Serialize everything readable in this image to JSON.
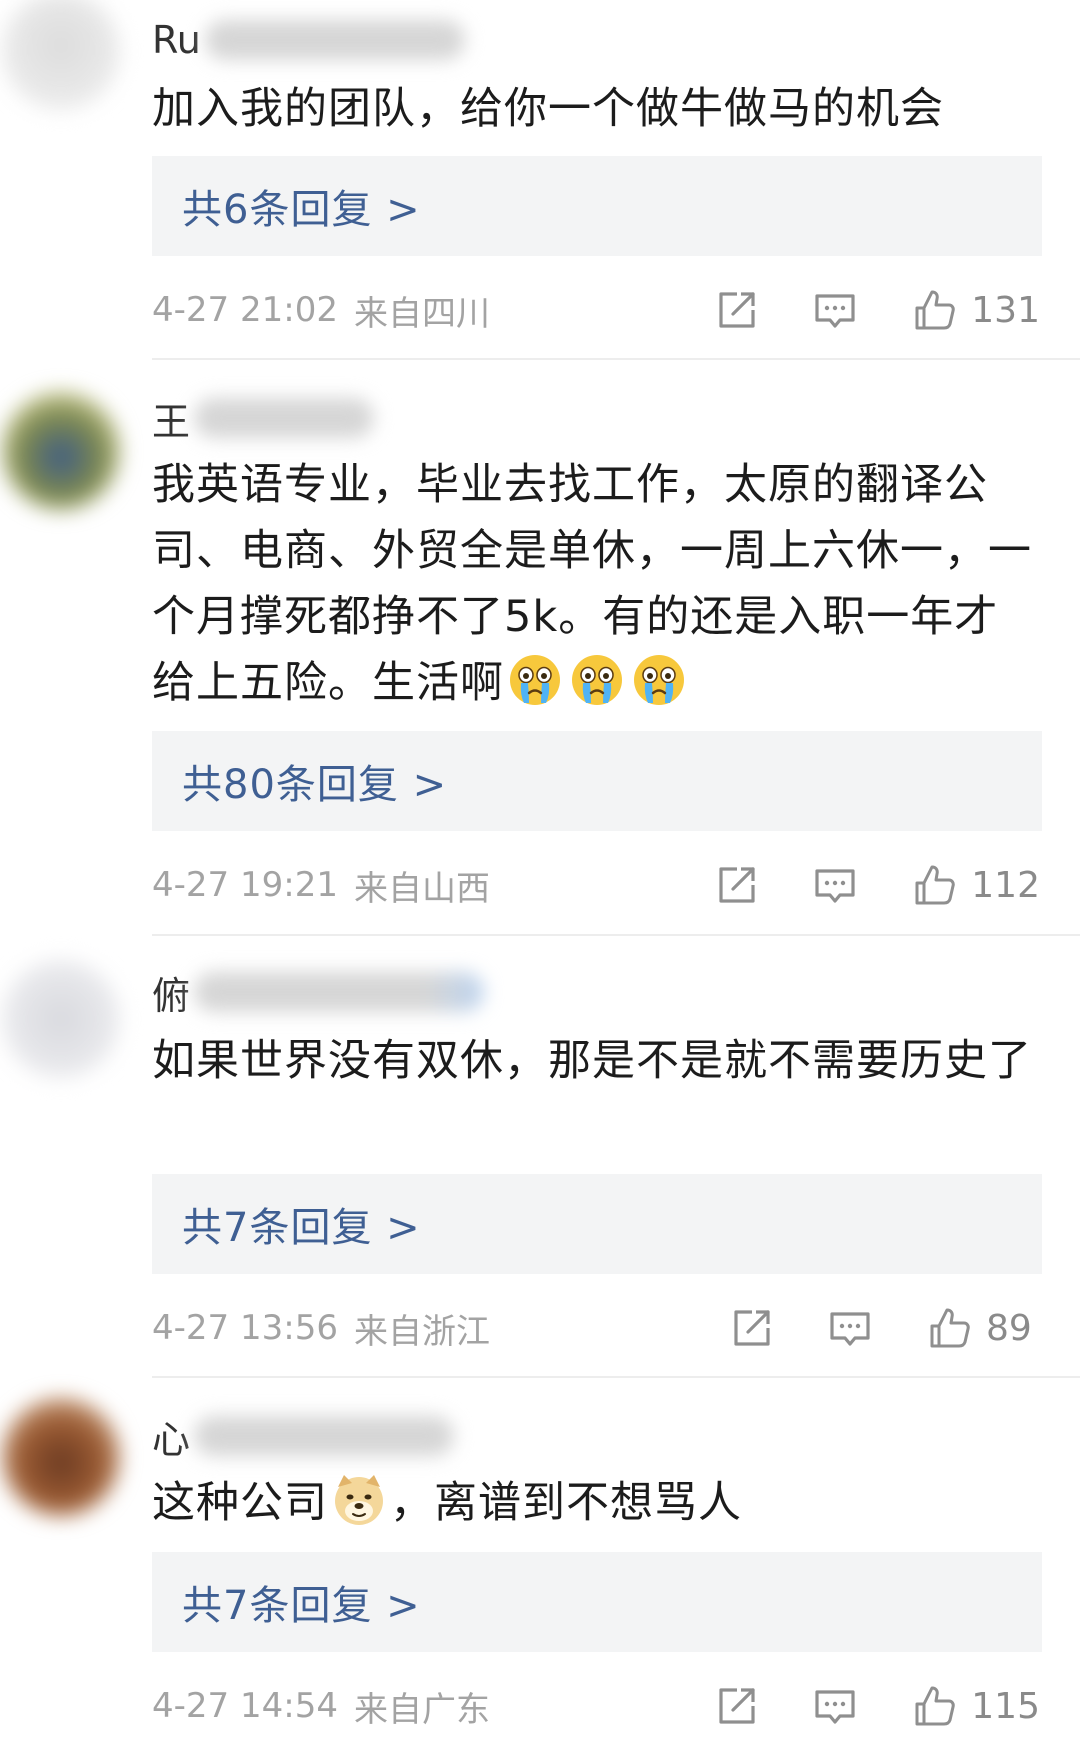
{
  "comments": [
    {
      "username_prefix": "Ru",
      "text": "加入我的团队，给你一个做牛做马的机会",
      "reply_label": "共6条回复 >",
      "time": "4-27 21:02",
      "location": "来自四川",
      "likes": "131",
      "avatar_color": "#e6e6e6"
    },
    {
      "username_prefix": "王",
      "text": "我英语专业，毕业去找工作，太原的翻译公司、电商、外贸全是单休，一周上六休一，一个月撑死都挣不了5k。有的还是入职一年才给上五险。生活啊",
      "emojis": [
        "crying-emoji",
        "crying-emoji",
        "crying-emoji"
      ],
      "reply_label": "共80条回复 >",
      "time": "4-27 19:21",
      "location": "来自山西",
      "likes": "112",
      "avatar_color": "#8a8f55"
    },
    {
      "username_prefix": "俯",
      "text": "如果世界没有双休，那是不是就不需要历史了",
      "reply_label": "共7条回复 >",
      "time": "4-27 13:56",
      "location": "来自浙江",
      "likes": "89",
      "avatar_color": "#e8e8ea"
    },
    {
      "username_prefix": "心",
      "text_before_emoji": "这种公司",
      "emoji": "doge-emoji",
      "text_after_emoji": "，离谱到不想骂人",
      "reply_label": "共7条回复 >",
      "time": "4-27 14:54",
      "location": "来自广东",
      "likes": "115",
      "avatar_color": "#8a4a2a"
    }
  ],
  "colors": {
    "reply_link": "#3f5f93",
    "meta_text": "#a3a3a3",
    "reply_box_bg": "#f3f4f5",
    "icon": "#8f8f8f"
  },
  "icons": [
    "share-icon",
    "comment-icon",
    "like-icon"
  ]
}
